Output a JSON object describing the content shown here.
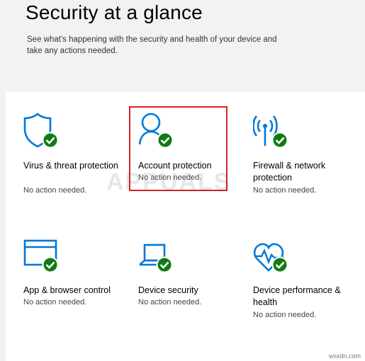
{
  "header": {
    "title": "Security at a glance",
    "subtitle": "See what's happening with the security and health of your device and take any actions needed."
  },
  "tiles": [
    {
      "label": "Virus & threat protection",
      "status": "No action needed.",
      "icon": "shield-icon"
    },
    {
      "label": "Account protection",
      "status": "No action needed.",
      "icon": "person-icon"
    },
    {
      "label": "Firewall & network protection",
      "status": "No action needed.",
      "icon": "antenna-icon"
    },
    {
      "label": "App & browser control",
      "status": "No action needed.",
      "icon": "browser-window-icon"
    },
    {
      "label": "Device security",
      "status": "No action needed.",
      "icon": "laptop-icon"
    },
    {
      "label": "Device performance & health",
      "status": "No action needed.",
      "icon": "heart-pulse-icon"
    }
  ],
  "watermark": "APPUALS",
  "footer": "wsxdn.com",
  "colors": {
    "icon_blue": "#0078d7",
    "check_green": "#107c10",
    "highlight_red": "#d32121"
  }
}
